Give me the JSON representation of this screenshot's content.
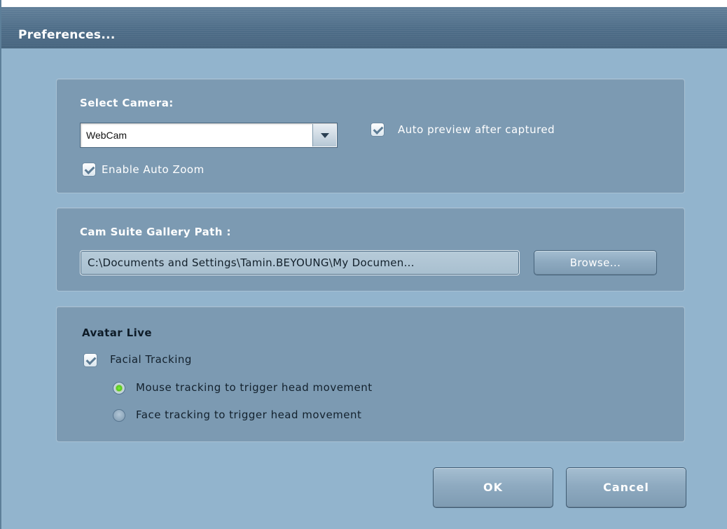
{
  "window": {
    "title": "Preferences..."
  },
  "camera": {
    "heading": "Select Camera:",
    "selected": "WebCam",
    "auto_preview_label": "Auto preview after captured",
    "auto_preview_checked": true,
    "auto_zoom_label": "Enable Auto Zoom",
    "auto_zoom_checked": true
  },
  "gallery": {
    "heading": "Cam Suite Gallery Path :",
    "path": "C:\\Documents and Settings\\Tamin.BEYOUNG\\My Documen...",
    "browse_label": "Browse..."
  },
  "avatar": {
    "heading": "Avatar Live",
    "facial_tracking_label": "Facial Tracking",
    "facial_tracking_checked": true,
    "options": [
      {
        "label": "Mouse tracking to trigger head movement",
        "selected": true
      },
      {
        "label": "Face tracking to trigger head movement",
        "selected": false
      }
    ]
  },
  "footer": {
    "ok_label": "OK",
    "cancel_label": "Cancel"
  }
}
